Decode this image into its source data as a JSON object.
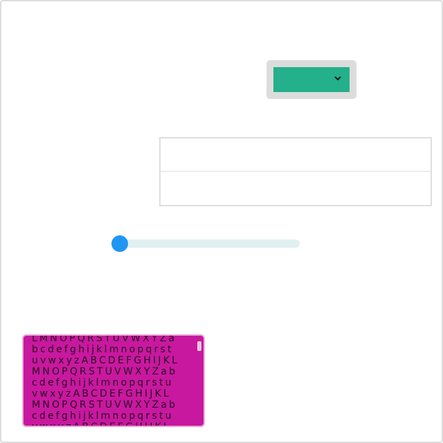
{
  "dropdown": {
    "selected_value": "",
    "accent_color": "#23b08a",
    "icon": "chevron-down-icon"
  },
  "fields": {
    "first_value": "",
    "second_value": ""
  },
  "slider": {
    "value_fraction": 0.0,
    "thumb_color": "#2196f3",
    "track_color": "#e0f0f0"
  },
  "text_box": {
    "background_color": "#c8189f",
    "lines": [
      "LMNOPQRSTUVWXYZa",
      "bcdefghijklmnopqrst",
      "uvwxyzABCDEFGHIJKL",
      "MNOPQRSTUVWXYZab",
      "cdefghijklmnopqrstu",
      "vwxyzABCDEFGHIJKL",
      "MNOPQRSTUVWXYZab",
      "cdefghijklmnopqrstu",
      "vwxyzABCDEFGHIJKL"
    ]
  }
}
